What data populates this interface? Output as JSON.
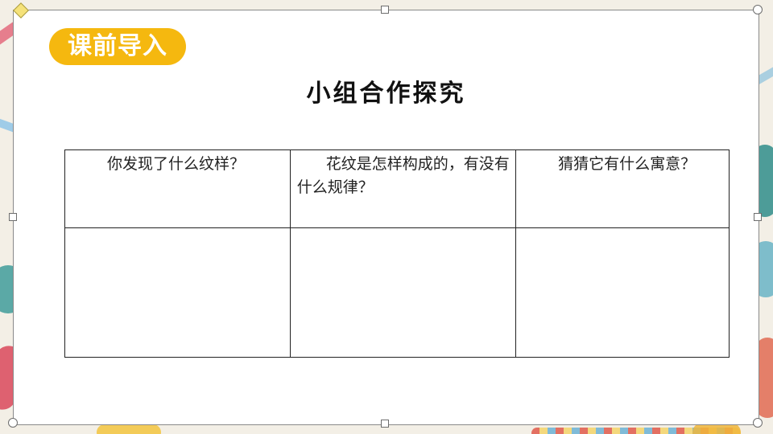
{
  "badge": {
    "label": "课前导入"
  },
  "title": "小组合作探究",
  "table": {
    "headers": [
      "你发现了什么纹样？",
      "花纹是怎样构成的，有没有什么规律？",
      "猜猜它有什么寓意？"
    ],
    "answers": [
      "",
      "",
      ""
    ]
  },
  "colors": {
    "badge": "#f5b80f",
    "slide_background": "#ffffff",
    "table_border": "#222222"
  }
}
